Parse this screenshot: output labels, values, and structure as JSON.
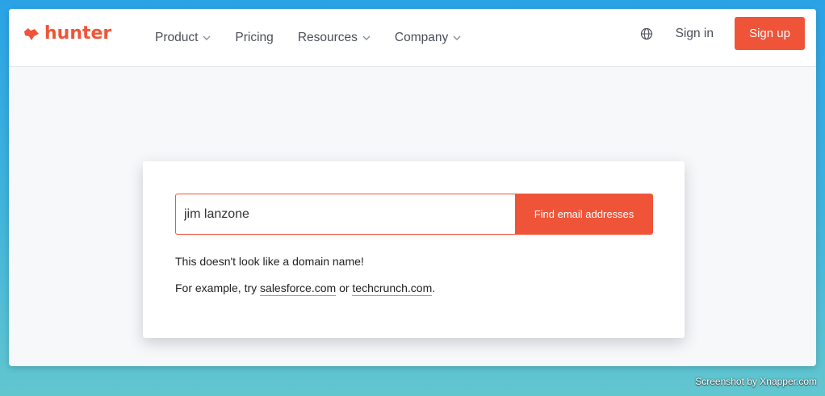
{
  "brand": {
    "name": "hunter",
    "color": "#f05438"
  },
  "nav": {
    "items": [
      {
        "label": "Product",
        "dropdown": true
      },
      {
        "label": "Pricing",
        "dropdown": false
      },
      {
        "label": "Resources",
        "dropdown": true
      },
      {
        "label": "Company",
        "dropdown": true
      }
    ],
    "language_icon": "globe-icon",
    "signin_label": "Sign in",
    "signup_label": "Sign up"
  },
  "search": {
    "value": "jim lanzone",
    "button_label": "Find email addresses"
  },
  "message": {
    "error": "This doesn't look like a domain name!",
    "example_prefix": "For example, try ",
    "example_link_1": "salesforce.com",
    "example_between": " or ",
    "example_link_2": "techcrunch.com",
    "example_suffix": "."
  },
  "watermark": "Screenshot by Xnapper.com"
}
